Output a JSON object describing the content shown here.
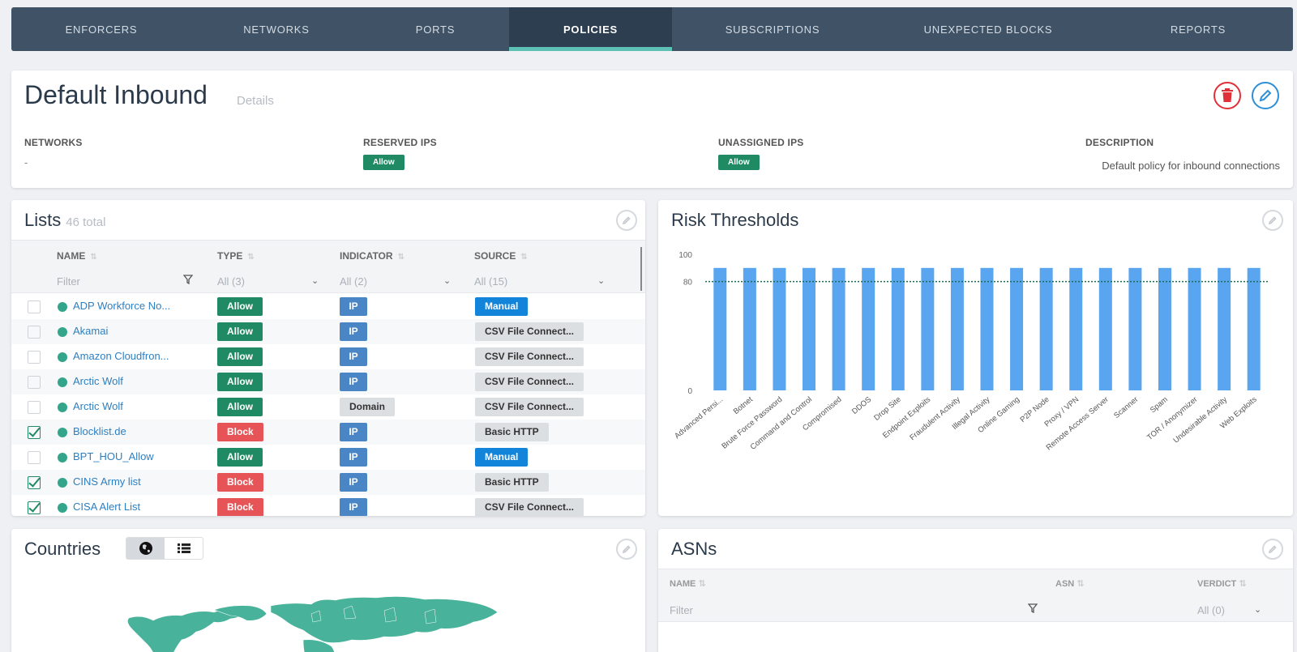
{
  "nav": {
    "tabs": [
      {
        "label": "ENFORCERS"
      },
      {
        "label": "NETWORKS"
      },
      {
        "label": "PORTS"
      },
      {
        "label": "POLICIES"
      },
      {
        "label": "SUBSCRIPTIONS"
      },
      {
        "label": "UNEXPECTED BLOCKS"
      },
      {
        "label": "REPORTS"
      }
    ],
    "active": "POLICIES"
  },
  "policy": {
    "title": "Default Inbound",
    "details_link": "Details",
    "networks_label": "NETWORKS",
    "networks_value": "-",
    "reserved_label": "RESERVED IPS",
    "reserved_value": "Allow",
    "unassigned_label": "UNASSIGNED IPS",
    "unassigned_value": "Allow",
    "description_label": "DESCRIPTION",
    "description_value": "Default policy for inbound connections",
    "delete_icon": "trash-icon",
    "edit_icon": "pencil-icon"
  },
  "lists": {
    "title": "Lists",
    "total": "46 total",
    "columns": {
      "name": "NAME",
      "type": "TYPE",
      "indicator": "INDICATOR",
      "source": "SOURCE"
    },
    "filters": {
      "name_placeholder": "Filter",
      "type": "All (3)",
      "indicator": "All (2)",
      "source": "All (15)"
    },
    "rows": [
      {
        "checked": false,
        "name": "ADP Workforce No...",
        "type": "Allow",
        "indicator": "IP",
        "source": "Manual"
      },
      {
        "checked": false,
        "name": "Akamai",
        "type": "Allow",
        "indicator": "IP",
        "source": "CSV File Connect..."
      },
      {
        "checked": false,
        "name": "Amazon Cloudfron...",
        "type": "Allow",
        "indicator": "IP",
        "source": "CSV File Connect..."
      },
      {
        "checked": false,
        "name": "Arctic Wolf",
        "type": "Allow",
        "indicator": "IP",
        "source": "CSV File Connect..."
      },
      {
        "checked": false,
        "name": "Arctic Wolf",
        "type": "Allow",
        "indicator": "Domain",
        "source": "CSV File Connect..."
      },
      {
        "checked": true,
        "name": "Blocklist.de",
        "type": "Block",
        "indicator": "IP",
        "source": "Basic HTTP"
      },
      {
        "checked": false,
        "name": "BPT_HOU_Allow",
        "type": "Allow",
        "indicator": "IP",
        "source": "Manual"
      },
      {
        "checked": true,
        "name": "CINS Army list",
        "type": "Block",
        "indicator": "IP",
        "source": "Basic HTTP"
      },
      {
        "checked": true,
        "name": "CISA Alert List",
        "type": "Block",
        "indicator": "IP",
        "source": "CSV File Connect..."
      }
    ]
  },
  "risk": {
    "title": "Risk Thresholds"
  },
  "chart_data": {
    "type": "bar",
    "categories": [
      "Advanced Persi...",
      "Botnet",
      "Brute Force Password",
      "Command and Control",
      "Compromised",
      "DDOS",
      "Drop Site",
      "Endpoint Exploits",
      "Fraudulent Activity",
      "Illegal Activity",
      "Online Gaming",
      "P2P Node",
      "Proxy / VPN",
      "Remote Access Server",
      "Scanner",
      "Spam",
      "TOR / Anonymizer",
      "Undesirable Activity",
      "Web Exploits"
    ],
    "values": [
      90,
      90,
      90,
      90,
      90,
      90,
      90,
      90,
      90,
      90,
      90,
      90,
      90,
      90,
      90,
      90,
      90,
      90,
      90
    ],
    "ylim": [
      0,
      100
    ],
    "yticks": [
      "0",
      "80",
      "100"
    ],
    "threshold": 80,
    "bar_color": "#5aa5ef",
    "threshold_color": "#1a6b4f",
    "grid": false
  },
  "countries": {
    "title": "Countries",
    "globe_icon": "globe-icon",
    "list_icon": "list-icon"
  },
  "asns": {
    "title": "ASNs",
    "columns": {
      "name": "NAME",
      "asn": "ASN",
      "verdict": "VERDICT"
    },
    "filters": {
      "name_placeholder": "Filter",
      "verdict": "All (0)"
    }
  }
}
